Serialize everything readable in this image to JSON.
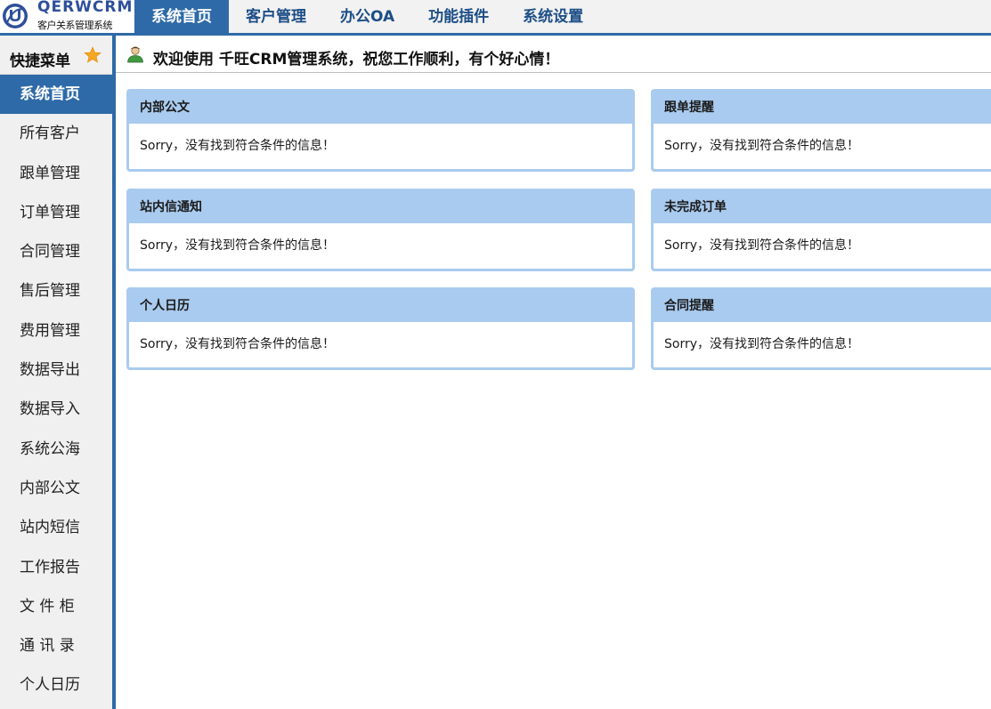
{
  "logo": {
    "title": "QERWCRM",
    "subtitle": "客户关系管理系统",
    "icon": "logo-u-icon",
    "color": "#2e4f9a"
  },
  "nav": {
    "tabs": [
      {
        "label": "系统首页",
        "active": true
      },
      {
        "label": "客户管理",
        "active": false
      },
      {
        "label": "办公OA",
        "active": false
      },
      {
        "label": "功能插件",
        "active": false
      },
      {
        "label": "系统设置",
        "active": false
      }
    ]
  },
  "sidebar": {
    "quick_label": "快捷菜单",
    "quick_icon": "star-icon",
    "items": [
      {
        "label": "系统首页",
        "active": true
      },
      {
        "label": "所有客户"
      },
      {
        "label": "跟单管理"
      },
      {
        "label": "订单管理"
      },
      {
        "label": "合同管理"
      },
      {
        "label": "售后管理"
      },
      {
        "label": "费用管理"
      },
      {
        "label": "数据导出"
      },
      {
        "label": "数据导入"
      },
      {
        "label": "系统公海"
      },
      {
        "label": "内部公文"
      },
      {
        "label": "站内短信"
      },
      {
        "label": "工作报告"
      },
      {
        "label": "文 件 柜"
      },
      {
        "label": "通 讯 录"
      },
      {
        "label": "个人日历"
      }
    ]
  },
  "welcome": {
    "icon": "user-icon",
    "text": "欢迎使用 千旺CRM管理系统，祝您工作顺利，有个好心情！"
  },
  "panels": [
    {
      "title": "内部公文",
      "message": "Sorry，没有找到符合条件的信息！"
    },
    {
      "title": "跟单提醒",
      "message": "Sorry，没有找到符合条件的信息！"
    },
    {
      "title": "站内信通知",
      "message": "Sorry，没有找到符合条件的信息！"
    },
    {
      "title": "未完成订单",
      "message": "Sorry，没有找到符合条件的信息！"
    },
    {
      "title": "个人日历",
      "message": "Sorry，没有找到符合条件的信息！"
    },
    {
      "title": "合同提醒",
      "message": "Sorry，没有找到符合条件的信息！"
    }
  ],
  "colors": {
    "accent": "#2e6aa8",
    "panel_header": "#a9cbef",
    "star": "#f5a623"
  }
}
